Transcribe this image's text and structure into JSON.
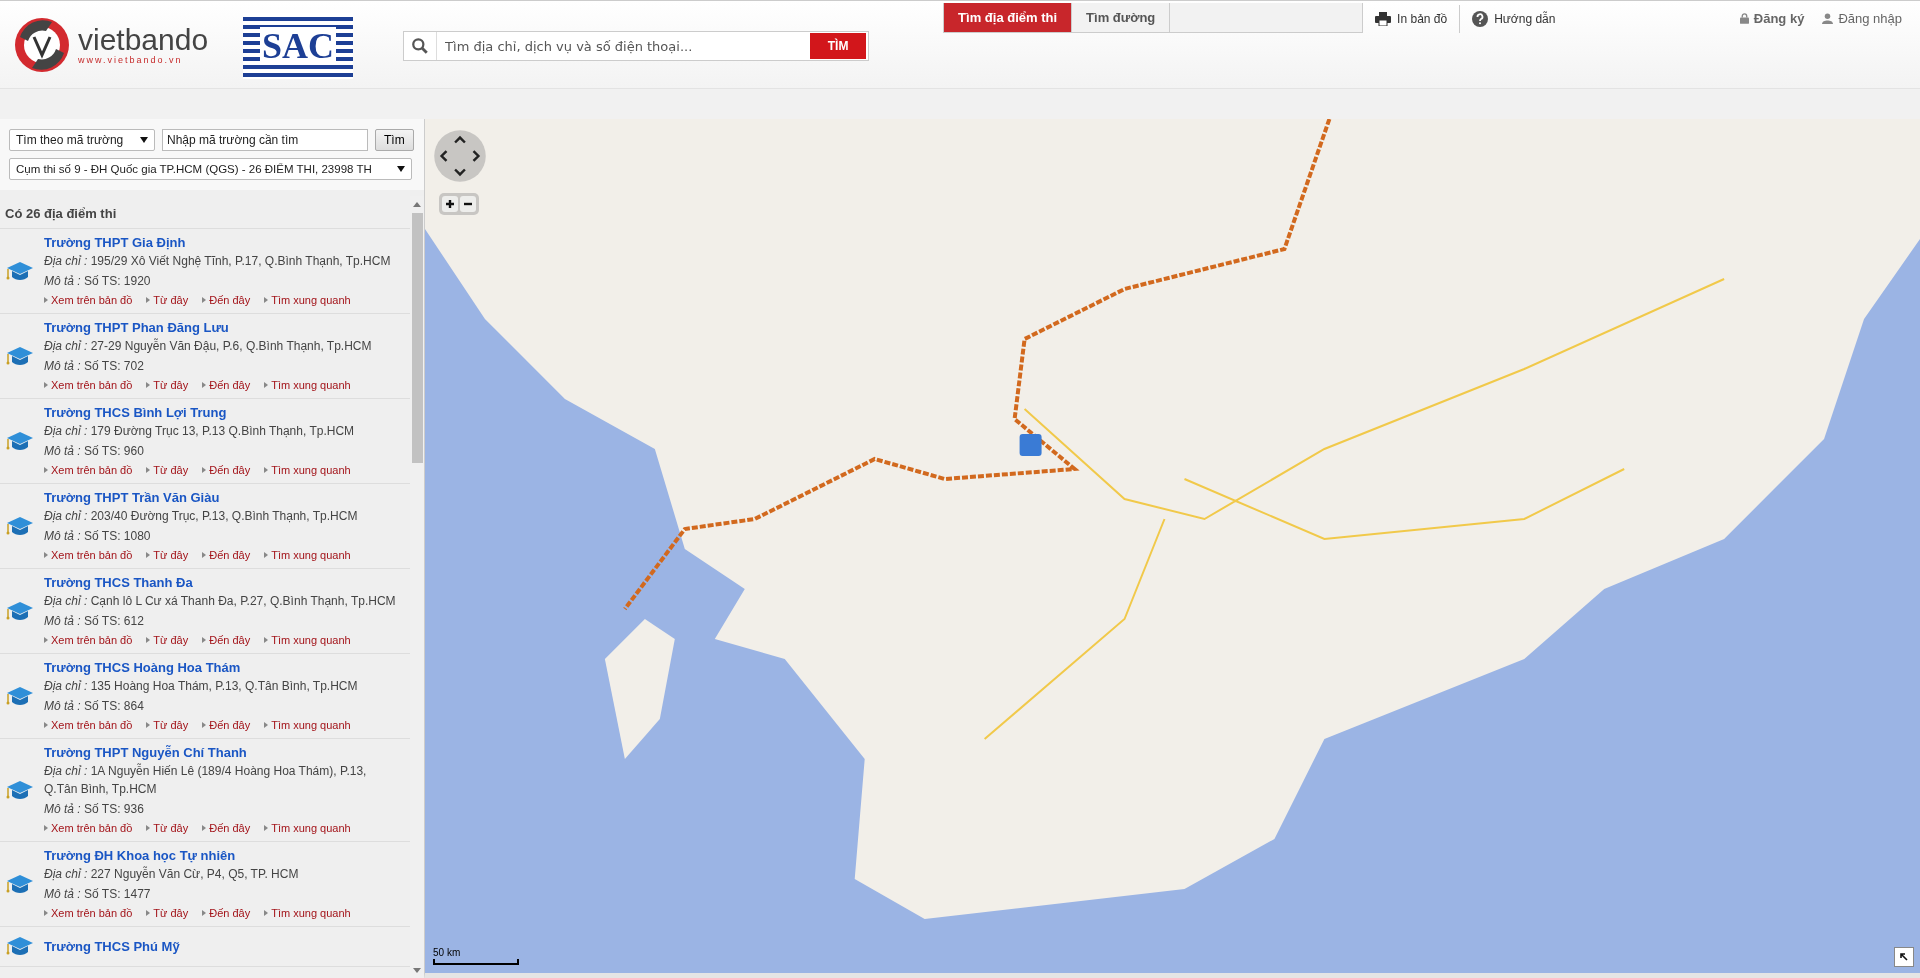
{
  "header": {
    "logo": {
      "name": "vietbando",
      "url": "www.vietbando.vn"
    },
    "partner_logo": {
      "text": "SAC"
    },
    "search": {
      "placeholder": "Tìm địa chỉ, dịch vụ và số điện thoại...",
      "button": "TÌM"
    },
    "tabs": [
      {
        "label": "Tìm địa điểm thi",
        "selected": true
      },
      {
        "label": "Tìm đường",
        "selected": false
      }
    ],
    "tools": [
      {
        "label": "In bản đồ",
        "kind": "print"
      },
      {
        "label": "Hướng dẫn",
        "kind": "help"
      }
    ],
    "account": [
      {
        "label": "Đăng ký",
        "kind": "lock"
      },
      {
        "label": "Đăng nhập",
        "kind": "user"
      }
    ]
  },
  "sidebar": {
    "search_mode": "Tìm theo mã trường",
    "code_field": {
      "placeholder": "Nhập mã trường cần tìm"
    },
    "search_button": "Tìm",
    "cluster": "Cụm thi số 9 - ĐH Quốc gia TP.HCM (QGS) - 26 ĐIỂM THI, 23998 TH",
    "results_heading": "Có 26 địa điểm thi",
    "results": [
      {
        "name": "Trường THPT Gia Định",
        "address": "*Địa chỉ :* 195/29 Xô Viết Nghệ Tĩnh, P.17, Q.Bình Thạnh, Tp.HCM",
        "description": "*Mô tả :* Số TS: 1920",
        "actions": [
          "Xem trên bản đồ",
          "Từ đây",
          "Đến đây",
          "Tìm xung quanh"
        ]
      },
      {
        "name": "Trường THPT Phan Đăng Lưu",
        "address": "*Địa chỉ :* 27-29 Nguyễn Văn Đậu, P.6, Q.Bình Thạnh, Tp.HCM",
        "description": "*Mô tả :* Số TS: 702",
        "actions": [
          "Xem trên bản đồ",
          "Từ đây",
          "Đến đây",
          "Tìm xung quanh"
        ]
      },
      {
        "name": "Trường THCS Bình Lợi Trung",
        "address": "*Địa chỉ :* 179 Đường Trục 13, P.13 Q.Bình Thạnh, Tp.HCM",
        "description": "*Mô tả :* Số TS: 960",
        "actions": [
          "Xem trên bản đồ",
          "Từ đây",
          "Đến đây",
          "Tìm xung quanh"
        ]
      },
      {
        "name": "Trường THPT Trần Văn Giàu",
        "address": "*Địa chỉ :* 203/40 Đường Trục, P.13, Q.Bình Thạnh, Tp.HCM",
        "description": "*Mô tả :* Số TS: 1080",
        "actions": [
          "Xem trên bản đồ",
          "Từ đây",
          "Đến đây",
          "Tìm xung quanh"
        ]
      },
      {
        "name": "Trường THCS Thanh Đa",
        "address": "*Địa chỉ :* Cạnh lô L Cư xá Thanh Đa, P.27, Q.Bình Thạnh, Tp.HCM",
        "description": "*Mô tả :* Số TS: 612",
        "actions": [
          "Xem trên bản đồ",
          "Từ đây",
          "Đến đây",
          "Tìm xung quanh"
        ]
      },
      {
        "name": "Trường THCS Hoàng Hoa Thám",
        "address": "*Địa chỉ :* 135 Hoàng Hoa Thám, P.13, Q.Tân Bình, Tp.HCM",
        "description": "*Mô tả :* Số TS: 864",
        "actions": [
          "Xem trên bản đồ",
          "Từ đây",
          "Đến đây",
          "Tìm xung quanh"
        ]
      },
      {
        "name": "Trường THPT Nguyễn Chí Thanh",
        "address": "*Địa chỉ :* 1A Nguyễn Hiến Lê (189/4 Hoàng Hoa Thám), P.13, Q.Tân Bình, Tp.HCM",
        "description": "*Mô tả :* Số TS: 936",
        "actions": [
          "Xem trên bản đồ",
          "Từ đây",
          "Đến đây",
          "Tìm xung quanh"
        ]
      },
      {
        "name": "Trường ĐH Khoa học Tự nhiên",
        "address": "*Địa chỉ :* 227 Nguyễn Văn Cừ, P4, Q5, TP. HCM",
        "description": "*Mô tả :* Số TS: 1477",
        "actions": [
          "Xem trên bản đồ",
          "Từ đây",
          "Đến đây",
          "Tìm xung quanh"
        ]
      },
      {
        "name": "Trường THCS Phú Mỹ"
      }
    ]
  },
  "map": {
    "scale_label": "50 km"
  }
}
